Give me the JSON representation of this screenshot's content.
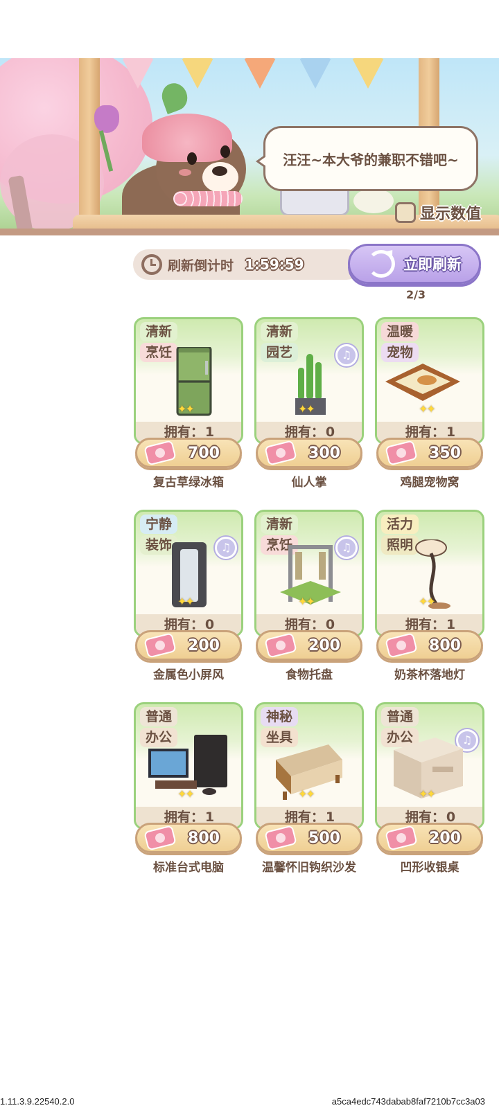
{
  "banner": {
    "speech": "汪汪~本大爷的兼职不错吧~",
    "show_values_label": "显示数值",
    "show_values_checked": false,
    "flag_colors": [
      "#f7c9d6",
      "#f6d77d",
      "#f5a879",
      "#a9d2ef",
      "#f6d77d"
    ]
  },
  "refresh": {
    "countdown_label": "刷新倒计时",
    "countdown_value": "1:59:59",
    "button_label": "立即刷新",
    "count": "2/3"
  },
  "items": [
    {
      "tag1": "清新",
      "tag1_style": "fresh",
      "tag2": "烹饪",
      "tag2_style": "cook",
      "music": false,
      "own_label": "拥有：",
      "own": "1",
      "price": "700",
      "name": "复古草绿冰箱",
      "art": "fridge"
    },
    {
      "tag1": "清新",
      "tag1_style": "fresh",
      "tag2": "园艺",
      "tag2_style": "garden",
      "music": true,
      "own_label": "拥有：",
      "own": "0",
      "price": "300",
      "name": "仙人掌",
      "art": "cactus"
    },
    {
      "tag1": "温暖",
      "tag1_style": "warm",
      "tag2": "宠物",
      "tag2_style": "pet",
      "music": false,
      "own_label": "拥有：",
      "own": "1",
      "price": "350",
      "name": "鸡腿宠物窝",
      "art": "petbed"
    },
    {
      "tag1": "宁静",
      "tag1_style": "quiet",
      "tag2": "装饰",
      "tag2_style": "deco",
      "music": true,
      "own_label": "拥有：",
      "own": "0",
      "price": "200",
      "name": "金属色小屏风",
      "art": "screen"
    },
    {
      "tag1": "清新",
      "tag1_style": "fresh",
      "tag2": "烹饪",
      "tag2_style": "cook",
      "music": true,
      "own_label": "拥有：",
      "own": "0",
      "price": "200",
      "name": "食物托盘",
      "art": "tray"
    },
    {
      "tag1": "活力",
      "tag1_style": "vital",
      "tag2": "照明",
      "tag2_style": "light",
      "music": false,
      "own_label": "拥有：",
      "own": "1",
      "price": "800",
      "name": "奶茶杯落地灯",
      "art": "lamp"
    },
    {
      "tag1": "普通",
      "tag1_style": "normal",
      "tag2": "办公",
      "tag2_style": "office",
      "music": false,
      "own_label": "拥有：",
      "own": "1",
      "price": "800",
      "name": "标准台式电脑",
      "art": "computer"
    },
    {
      "tag1": "神秘",
      "tag1_style": "mystic",
      "tag2": "坐具",
      "tag2_style": "seat",
      "music": false,
      "own_label": "拥有：",
      "own": "1",
      "price": "500",
      "name": "温馨怀旧钩织沙发",
      "art": "sofa"
    },
    {
      "tag1": "普通",
      "tag1_style": "normal",
      "tag2": "办公",
      "tag2_style": "office",
      "music": true,
      "own_label": "拥有：",
      "own": "0",
      "price": "200",
      "name": "凹形收银桌",
      "art": "desk"
    }
  ],
  "footer": {
    "version": "1.11.3.9.22540.2.0",
    "hash": "a5ca4edc743dabab8faf7210b7cc3a03"
  }
}
